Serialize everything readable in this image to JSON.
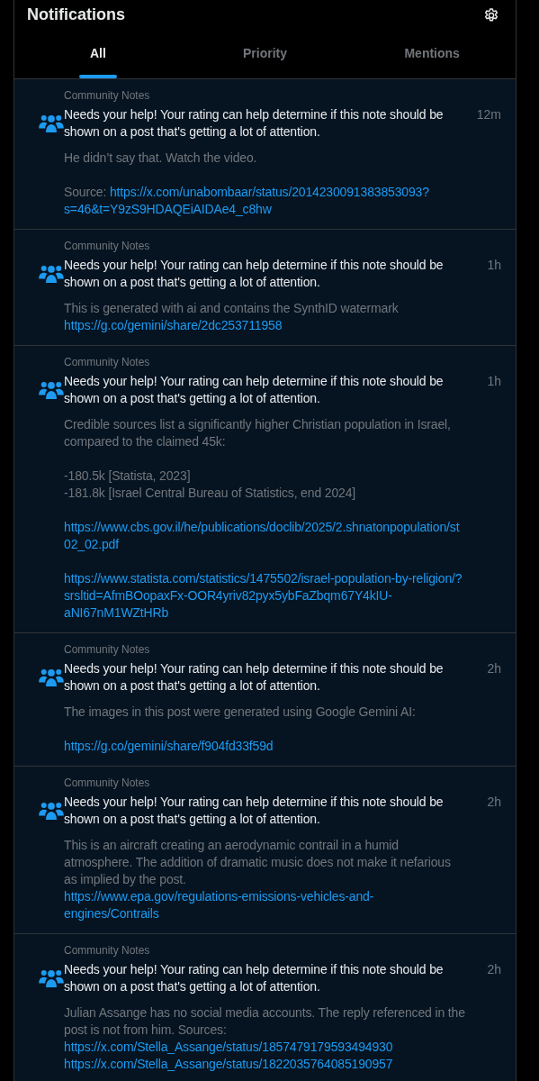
{
  "header": {
    "title": "Notifications"
  },
  "tabs": [
    {
      "label": "All",
      "selected": true
    },
    {
      "label": "Priority",
      "selected": false
    },
    {
      "label": "Mentions",
      "selected": false
    }
  ],
  "notifications": [
    {
      "category": "Community Notes",
      "headline": "Needs your help! Your rating can help determine if this note should be shown on a post that's getting a lot of attention.",
      "time": "12m",
      "paragraphs": [
        [
          {
            "kind": "text",
            "text": "He didn’t say that. Watch the video."
          }
        ],
        [
          {
            "kind": "source",
            "label": "Source:",
            "text": "https://x.com/unabombaar/status/2014230091383853093?s=46&t=Y9zS9HDAQEiAIDAe4_c8hw"
          }
        ]
      ]
    },
    {
      "category": "Community Notes",
      "headline": "Needs your help! Your rating can help determine if this note should be shown on a post that's getting a lot of attention.",
      "time": "1h",
      "paragraphs": [
        [
          {
            "kind": "text",
            "text": "This is generated with ai and contains the SynthID watermark"
          },
          {
            "kind": "link",
            "text": "https://g.co/gemini/share/2dc253711958"
          }
        ]
      ]
    },
    {
      "category": "Community Notes",
      "headline": "Needs your help! Your rating can help determine if this note should be shown on a post that's getting a lot of attention.",
      "time": "1h",
      "paragraphs": [
        [
          {
            "kind": "text",
            "text": "Credible sources list a significantly higher Christian population in Israel, compared to the claimed 45k:"
          }
        ],
        [
          {
            "kind": "text",
            "text": "-180.5k [Statista, 2023]"
          },
          {
            "kind": "text",
            "text": "-181.8k [Israel Central Bureau of Statistics, end 2024]"
          }
        ],
        [
          {
            "kind": "link",
            "text": "https://www.cbs.gov.il/he/publications/doclib/2025/2.shnatonpopulation/st02_02.pdf"
          }
        ],
        [
          {
            "kind": "link",
            "text": "https://www.statista.com/statistics/1475502/israel-population-by-religion/?srsltid=AfmBOopaxFx-OOR4yriv82pyx5ybFaZbqm67Y4kIU-aNI67nM1WZtHRb"
          }
        ]
      ]
    },
    {
      "category": "Community Notes",
      "headline": "Needs your help! Your rating can help determine if this note should be shown on a post that's getting a lot of attention.",
      "time": "2h",
      "paragraphs": [
        [
          {
            "kind": "text",
            "text": "The images in this post were generated using Google Gemini AI:"
          }
        ],
        [
          {
            "kind": "link",
            "text": "https://g.co/gemini/share/f904fd33f59d"
          }
        ]
      ]
    },
    {
      "category": "Community Notes",
      "headline": "Needs your help! Your rating can help determine if this note should be shown on a post that's getting a lot of attention.",
      "time": "2h",
      "paragraphs": [
        [
          {
            "kind": "text",
            "text": "This is an aircraft creating an aerodynamic contrail in a humid atmosphere. The addition of dramatic music does not make it nefarious as implied by the post."
          },
          {
            "kind": "link",
            "text": "https://www.epa.gov/regulations-emissions-vehicles-and-engines/Contrails"
          }
        ]
      ]
    },
    {
      "category": "Community Notes",
      "headline": "Needs your help! Your rating can help determine if this note should be shown on a post that's getting a lot of attention.",
      "time": "2h",
      "paragraphs": [
        [
          {
            "kind": "text",
            "text": "Julian Assange has no social media accounts. The reply referenced in the post is not from him. Sources:"
          },
          {
            "kind": "link",
            "text": "https://x.com/Stella_Assange/status/1857479179593494930"
          },
          {
            "kind": "link",
            "text": "https://x.com/Stella_Assange/status/1822035764085190957"
          }
        ]
      ]
    }
  ]
}
